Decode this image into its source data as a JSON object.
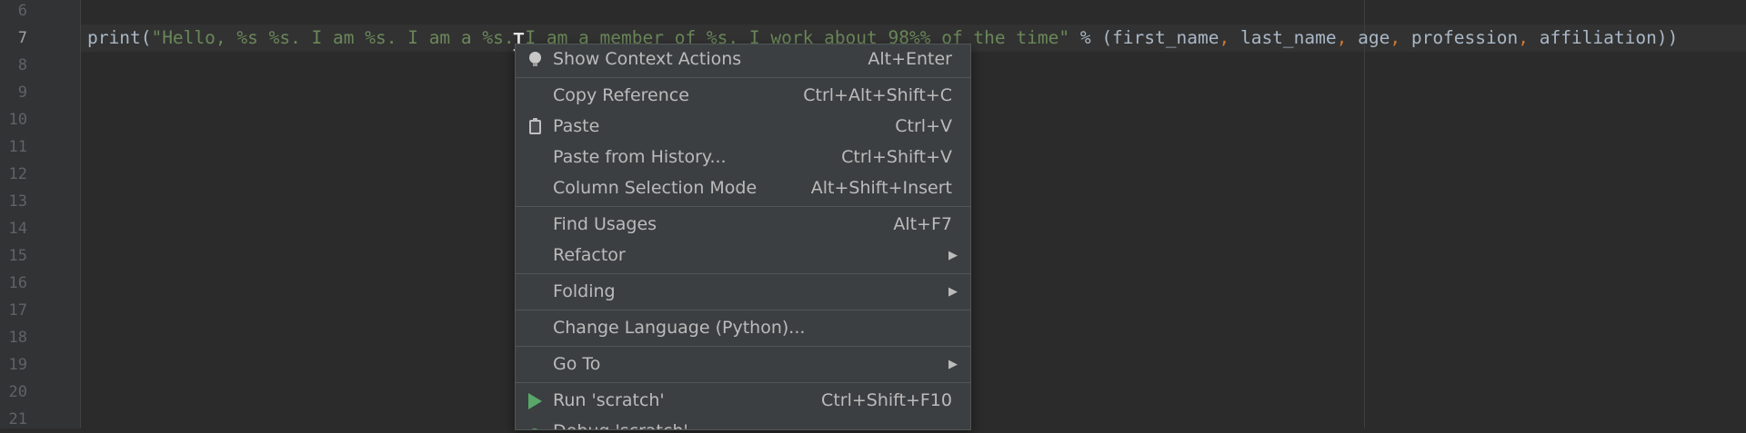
{
  "editor": {
    "line_numbers": [
      "6",
      "7",
      "8",
      "9",
      "10",
      "11",
      "12",
      "13",
      "14",
      "15",
      "16",
      "17",
      "18",
      "19",
      "20",
      "21"
    ],
    "current_line": "7",
    "code_tokens": [
      {
        "text": "print(",
        "kind": "fn"
      },
      {
        "text": "\"Hello, %s %s. I am %s. I am a %s. I am a member of %s. I work about 98%% of the time\"",
        "kind": "str"
      },
      {
        "text": " % (first_name",
        "kind": "op"
      },
      {
        "text": ",",
        "kind": "comma"
      },
      {
        "text": " last_name",
        "kind": "op"
      },
      {
        "text": ",",
        "kind": "comma"
      },
      {
        "text": " age",
        "kind": "op"
      },
      {
        "text": ",",
        "kind": "comma"
      },
      {
        "text": " profession",
        "kind": "op"
      },
      {
        "text": ",",
        "kind": "comma"
      },
      {
        "text": " affiliation))",
        "kind": "op"
      }
    ],
    "caret_glyph": "I"
  },
  "context_menu": {
    "items": [
      {
        "label": "Show Context Actions",
        "shortcut": "Alt+Enter",
        "icon": "lightbulb-icon"
      },
      {
        "label": "Copy Reference",
        "shortcut": "Ctrl+Alt+Shift+C"
      },
      {
        "label": "Paste",
        "shortcut": "Ctrl+V",
        "icon": "clipboard-icon"
      },
      {
        "label": "Paste from History...",
        "shortcut": "Ctrl+Shift+V"
      },
      {
        "label": "Column Selection Mode",
        "shortcut": "Alt+Shift+Insert"
      },
      {
        "label": "Find Usages",
        "shortcut": "Alt+F7"
      },
      {
        "label": "Refactor",
        "shortcut": "",
        "submenu": true
      },
      {
        "label": "Folding",
        "shortcut": "",
        "submenu": true
      },
      {
        "label": "Change Language (Python)...",
        "shortcut": ""
      },
      {
        "label": "Go To",
        "shortcut": "",
        "submenu": true
      },
      {
        "label": "Run 'scratch'",
        "shortcut": "Ctrl+Shift+F10",
        "icon": "run-icon"
      },
      {
        "label": "Debug 'scratch'",
        "shortcut": "",
        "icon": "debug-icon"
      }
    ],
    "submenu_arrow": "▶"
  },
  "colors": {
    "background": "#2b2b2b",
    "gutter": "#313335",
    "string": "#6a8759",
    "keyword_comma": "#cc7832",
    "menu_bg": "#3c3f41",
    "run_green": "#59a869"
  }
}
